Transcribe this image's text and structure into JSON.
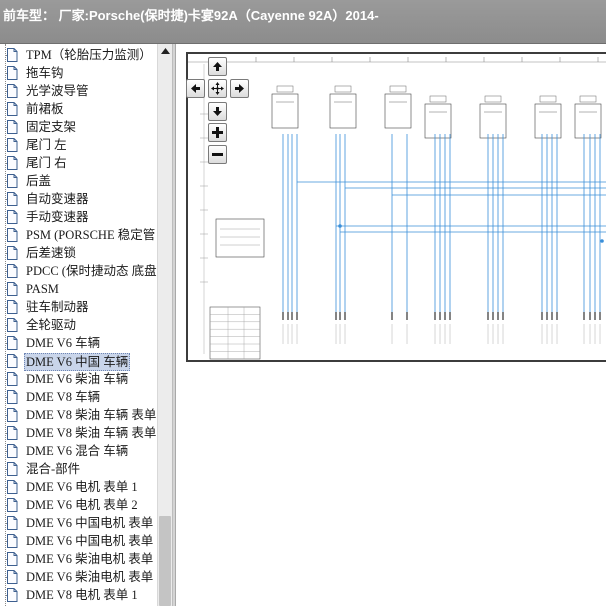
{
  "window": {
    "title": "前车型： 厂家:Porsche(保时捷)卡宴92A（Cayenne 92A）2014-"
  },
  "tree": {
    "items": [
      {
        "label": "TPM（轮胎压力监测）",
        "selected": false
      },
      {
        "label": "拖车钩",
        "selected": false
      },
      {
        "label": "光学波导管",
        "selected": false
      },
      {
        "label": "前裙板",
        "selected": false
      },
      {
        "label": "固定支架",
        "selected": false
      },
      {
        "label": "尾门 左",
        "selected": false
      },
      {
        "label": "尾门 右",
        "selected": false
      },
      {
        "label": "后盖",
        "selected": false
      },
      {
        "label": "自动变速器",
        "selected": false
      },
      {
        "label": "手动变速器",
        "selected": false
      },
      {
        "label": "PSM (PORSCHE 稳定管",
        "selected": false
      },
      {
        "label": "后差速锁",
        "selected": false
      },
      {
        "label": "PDCC (保时捷动态 底盘",
        "selected": false
      },
      {
        "label": "PASM",
        "selected": false
      },
      {
        "label": "驻车制动器",
        "selected": false
      },
      {
        "label": "全轮驱动",
        "selected": false
      },
      {
        "label": "DME V6 车辆",
        "selected": false
      },
      {
        "label": "DME V6 中国 车辆",
        "selected": true
      },
      {
        "label": "DME V6 柴油 车辆",
        "selected": false
      },
      {
        "label": "DME V8 车辆",
        "selected": false
      },
      {
        "label": "DME V8 柴油 车辆 表单",
        "selected": false
      },
      {
        "label": "DME V8 柴油 车辆 表单",
        "selected": false
      },
      {
        "label": "DME V6 混合 车辆",
        "selected": false
      },
      {
        "label": "混合-部件",
        "selected": false
      },
      {
        "label": "DME V6 电机 表单 1",
        "selected": false
      },
      {
        "label": "DME V6 电机 表单 2",
        "selected": false
      },
      {
        "label": "DME V6 中国电机 表单",
        "selected": false
      },
      {
        "label": "DME V6 中国电机 表单",
        "selected": false
      },
      {
        "label": "DME V6 柴油电机 表单",
        "selected": false
      },
      {
        "label": "DME V6 柴油电机 表单",
        "selected": false
      },
      {
        "label": "DME V8 电机 表单 1",
        "selected": false
      }
    ]
  },
  "viewer": {
    "nav": {
      "up": "arrow-up-icon",
      "left": "arrow-left-icon",
      "center": "pan-center-icon",
      "right": "arrow-right-icon",
      "down": "arrow-down-icon",
      "zoom_in": "zoom-in-icon",
      "zoom_out": "zoom-out-icon"
    },
    "colors": {
      "wire_blue": "#3a8fd9",
      "frame": "#3c3c3c"
    }
  }
}
